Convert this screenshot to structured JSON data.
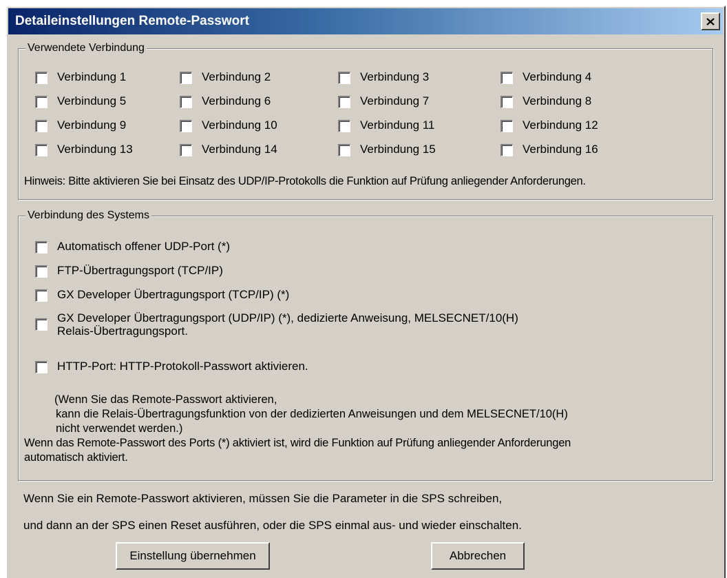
{
  "window": {
    "title": "Detaileinstellungen Remote-Passwort"
  },
  "connections_group": {
    "legend": "Verwendete Verbindung",
    "items": [
      {
        "label": "Verbindung 1",
        "checked": false
      },
      {
        "label": "Verbindung 2",
        "checked": false
      },
      {
        "label": "Verbindung 3",
        "checked": false
      },
      {
        "label": "Verbindung 4",
        "checked": false
      },
      {
        "label": "Verbindung 5",
        "checked": false
      },
      {
        "label": "Verbindung 6",
        "checked": false
      },
      {
        "label": "Verbindung 7",
        "checked": false
      },
      {
        "label": "Verbindung 8",
        "checked": false
      },
      {
        "label": "Verbindung 9",
        "checked": false
      },
      {
        "label": "Verbindung 10",
        "checked": false
      },
      {
        "label": "Verbindung 11",
        "checked": false
      },
      {
        "label": "Verbindung 12",
        "checked": false
      },
      {
        "label": "Verbindung 13",
        "checked": false
      },
      {
        "label": "Verbindung 14",
        "checked": false
      },
      {
        "label": "Verbindung 15",
        "checked": false
      },
      {
        "label": "Verbindung 16",
        "checked": false
      }
    ],
    "note": "Hinweis: Bitte aktivieren Sie bei Einsatz des UDP/IP-Protokolls die Funktion auf Prüfung anliegender Anforderungen."
  },
  "system_group": {
    "legend": "Verbindung des Systems",
    "items": [
      {
        "label": "Automatisch offener UDP-Port (*)",
        "checked": false
      },
      {
        "label": "FTP-Übertragungsport (TCP/IP)",
        "checked": false
      },
      {
        "label": "GX Developer Übertragungsport (TCP/IP) (*)",
        "checked": false
      },
      {
        "label_line1": "GX Developer Übertragungsport (UDP/IP) (*), dedizierte Anweisung, MELSECNET/10(H)",
        "label_line2": "Relais-Übertragungsport.",
        "checked": false
      },
      {
        "label": "HTTP-Port: HTTP-Protokoll-Passwort aktivieren.",
        "checked": false
      }
    ],
    "note_lines": [
      "(Wenn Sie das Remote-Passwort aktivieren,",
      "kann die Relais-Übertragungsfunktion von der dedizierten Anweisungen und dem MELSECNET/10(H)",
      "nicht verwendet werden.)"
    ],
    "note2_lines": [
      "Wenn das Remote-Passwort des Ports (*) aktiviert ist, wird die Funktion auf Prüfung anliegender Anforderungen",
      "automatisch aktiviert."
    ]
  },
  "footer": {
    "line1": "Wenn Sie ein Remote-Passwort aktivieren, müssen Sie die Parameter in die SPS schreiben,",
    "line2": "und dann an der SPS einen Reset ausführen, oder die SPS einmal aus- und wieder einschalten.",
    "apply_label": "Einstellung übernehmen",
    "cancel_label": "Abbrechen"
  },
  "icons": {
    "close": "close-icon",
    "checkbox": "checkbox-unchecked"
  },
  "colors": {
    "dialog_bg": "#d4d0c8",
    "title_start": "#0a246a",
    "title_end": "#a6caf0",
    "title_text": "#ffffff"
  }
}
